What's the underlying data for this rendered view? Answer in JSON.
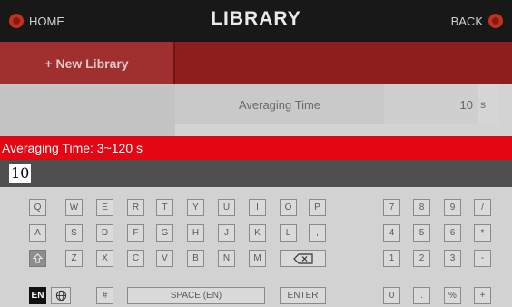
{
  "header": {
    "home_label": "HOME",
    "title": "LIBRARY",
    "back_label": "BACK"
  },
  "library": {
    "new_label": "+ New Library"
  },
  "parameter": {
    "label": "Averaging Time",
    "value": "10",
    "unit": "s"
  },
  "prompt": {
    "text": "Averaging Time: 3~120 s"
  },
  "input": {
    "value": "10"
  },
  "keyboard": {
    "row1": [
      "Q",
      "W",
      "E",
      "R",
      "T",
      "Y",
      "U",
      "I",
      "O",
      "P"
    ],
    "row2": [
      "A",
      "S",
      "D",
      "F",
      "G",
      "H",
      "J",
      "K",
      "L",
      ","
    ],
    "row3": [
      "Z",
      "X",
      "C",
      "V",
      "B",
      "N",
      "M"
    ],
    "lang": "EN",
    "hash": "#",
    "space": "SPACE (EN)",
    "enter": "ENTER",
    "numpad": [
      [
        "7",
        "8",
        "9",
        "/"
      ],
      [
        "4",
        "5",
        "6",
        "*"
      ],
      [
        "1",
        "2",
        "3",
        "-"
      ],
      [
        "0",
        ".",
        "%",
        "+"
      ]
    ]
  },
  "icons": {
    "home": "home-icon",
    "back": "back-icon",
    "shift": "shift-icon",
    "backspace": "backspace-icon",
    "globe": "globe-icon"
  },
  "colors": {
    "accent_red": "#e30613",
    "header_bg": "#181818",
    "library_bar": "#8e1f1f"
  }
}
